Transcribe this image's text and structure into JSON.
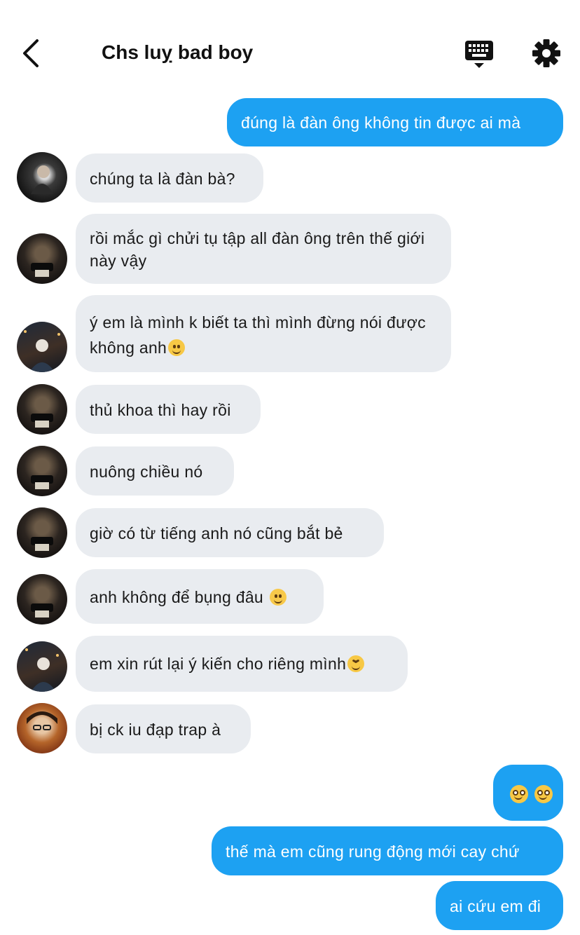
{
  "header": {
    "title": "Chs luỵ bad boy",
    "back_icon": "chevron-left-icon",
    "keyboard_icon": "keyboard-icon",
    "settings_icon": "gear-icon"
  },
  "colors": {
    "outgoing_bubble": "#1da1f2",
    "incoming_bubble": "#e9ecf0",
    "background": "#ffffff"
  },
  "messages": [
    {
      "direction": "out",
      "text": "đúng là đàn ông không tin được ai mà"
    },
    {
      "direction": "in",
      "text": "chúng ta là đàn bà?"
    },
    {
      "direction": "in",
      "text": "rồi mắc gì chửi tụ tập all đàn ông trên thế giới này vậy"
    },
    {
      "direction": "in",
      "text": "ý em là mình k biết ta thì mình đừng nói được không anh",
      "emoji": "slightly-smiling-face"
    },
    {
      "direction": "in",
      "text": "thủ khoa thì hay rồi"
    },
    {
      "direction": "in",
      "text": "nuông chiều nó"
    },
    {
      "direction": "in",
      "text": "giờ có từ tiếng anh nó cũng bắt bẻ"
    },
    {
      "direction": "in",
      "text": "anh không để bụng đâu ",
      "emoji": "smiling-face-with-smiling-eyes"
    },
    {
      "direction": "in",
      "text": "em xin rút lại ý kiến cho riêng mình",
      "emoji": "persevering-face"
    },
    {
      "direction": "in",
      "text": "bị ck iu đạp trap à"
    },
    {
      "direction": "out",
      "text": "",
      "emoji": "pleading-face-x2"
    },
    {
      "direction": "out",
      "text": "thế mà em cũng rung động mới cay chứ"
    },
    {
      "direction": "out",
      "text": "ai cứu em đi"
    }
  ]
}
